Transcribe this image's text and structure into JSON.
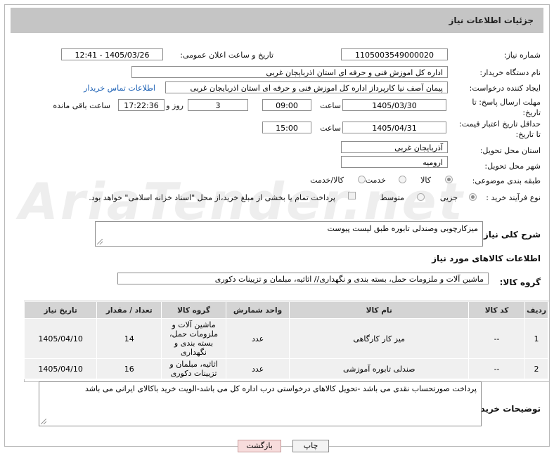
{
  "header": {
    "title": "جزئیات اطلاعات نیاز"
  },
  "watermark": "AriaTender.net",
  "fields": {
    "need_number_label": "شماره نیاز:",
    "need_number": "1105003549000020",
    "announce_label": "تاریخ و ساعت اعلان عمومی:",
    "announce_value": "1405/03/26 - 12:41",
    "buyer_org_label": "نام دستگاه خریدار:",
    "buyer_org": "اداره کل اموزش فنی و حرفه ای استان اذربایجان غربی",
    "creator_label": "ایجاد کننده درخواست:",
    "creator": "پیمان آصف نیا کارپرداز اداره کل اموزش فنی و حرفه ای استان اذربایجان غربی",
    "contact_link": "اطلاعات تماس خریدار",
    "deadline_label_1": "مهلت ارسال پاسخ: تا",
    "deadline_label_2": "تاریخ:",
    "deadline_date": "1405/03/30",
    "time_label": "ساعت",
    "deadline_time": "09:00",
    "days_value": "3",
    "days_label": "روز و",
    "remaining_time": "17:22:36",
    "remaining_label": "ساعت باقی مانده",
    "validity_label_1": "حداقل تاریخ اعتبار قیمت:",
    "validity_label_2": "تا تاریخ:",
    "validity_date": "1405/04/31",
    "validity_time": "15:00",
    "province_label": "استان محل تحویل:",
    "province": "آذربایجان غربی",
    "city_label": "شهر محل تحویل:",
    "city": "ارومیه",
    "category_label": "طبقه بندی موضوعی:",
    "category_options": [
      "کالا",
      "خدمت",
      "کالا/خدمت"
    ],
    "process_label": "نوع فرآیند خرید :",
    "process_options": [
      "جزیی",
      "متوسط"
    ],
    "payment_note": "پرداخت تمام یا بخشی از مبلغ خرید،از محل \"اسناد خزانه اسلامی\" خواهد بود."
  },
  "description": {
    "label": "شرح کلی نیاز:",
    "value": "میزکارچوبی وصندلی تابوره طبق لیست پیوست"
  },
  "goods_section": {
    "title": "اطلاعات کالاهای مورد نیاز",
    "group_label": "گروه کالا:",
    "group_value": "ماشین آلات و ملزومات حمل، بسته بندی و نگهداری// اثاثیه، مبلمان و تزیینات دکوری"
  },
  "table": {
    "headers": [
      "ردیف",
      "کد کالا",
      "نام کالا",
      "واحد شمارش",
      "گروه کالا",
      "تعداد / مقدار",
      "تاریخ نیاز"
    ],
    "rows": [
      [
        "1",
        "--",
        "میز کار کارگاهی",
        "عدد",
        "ماشین آلات و ملزومات حمل، بسته بندی و نگهداری",
        "14",
        "1405/04/10"
      ],
      [
        "2",
        "--",
        "صندلی تابوره آموزشی",
        "عدد",
        "اثاثیه، مبلمان و تزیینات دکوری",
        "16",
        "1405/04/10"
      ]
    ]
  },
  "buyer_notes": {
    "label": "توضیحات خریدار:",
    "value": "پرداخت صورتحساب نقدی می باشد -تحویل کالاهای درخواستی درب اداره کل می باشد-الویت خرید باکالای ایرانی می باشد"
  },
  "buttons": {
    "print": "چاپ",
    "back": "بازگشت"
  }
}
